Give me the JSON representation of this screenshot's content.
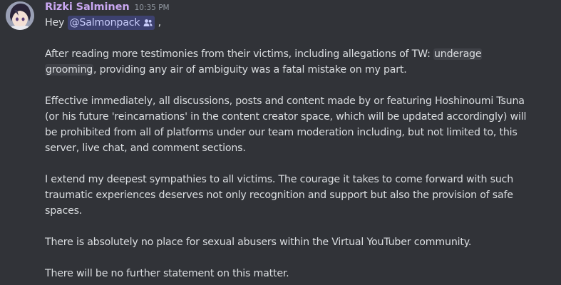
{
  "message": {
    "author": "Rizki Salminen",
    "timestamp": "10:35 PM",
    "greeting": "Hey",
    "mention": "@Salmonpack",
    "mention_icon": "user-group-icon",
    "after_mention": " ,",
    "p1_before": "After reading more testimonies from their victims, including allegations of TW: ",
    "p1_code_a": "underage",
    "p1_code_b": "grooming",
    "p1_after": ", providing any air of ambiguity was a fatal mistake on my part.",
    "p2_line1": "Effective immediately, all discussions, posts and content made by or featuring Hoshinoumi Tsuna",
    "p2_line2": "(or his future 'reincarnations' in the content creator space, which will be updated accordingly) will",
    "p2_line3": "be prohibited from all of platforms under our team moderation including, but not limited to, this",
    "p2_line4": "server, live chat, and comment sections.",
    "p3_line1": "I extend my deepest sympathies to all victims. The courage it takes to come forward with such",
    "p3_line2": "traumatic experiences deserves not only recognition and support but also the provision of safe",
    "p3_line3": "spaces.",
    "p4": "There is absolutely no place for sexual abusers within the Virtual YouTuber community.",
    "p5": "There will be no further statement on this matter."
  },
  "colors": {
    "background": "#313338",
    "username": "#c9a7f1",
    "text": "#dbdee1",
    "timestamp": "#949ba4",
    "mention_bg": "#5865f24d",
    "code_bg": "#3f4147"
  }
}
